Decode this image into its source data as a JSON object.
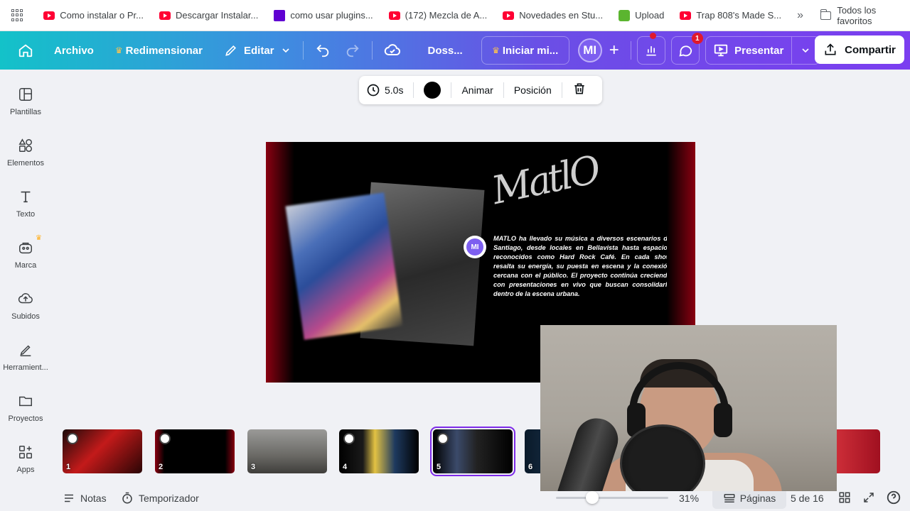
{
  "bookmarks": {
    "items": [
      {
        "label": "Como instalar o Pr...",
        "icon": "youtube-icon"
      },
      {
        "label": "Descargar Instalar...",
        "icon": "youtube-icon"
      },
      {
        "label": "como usar plugins...",
        "icon": "yahoo-icon"
      },
      {
        "label": "(172) Mezcla de A...",
        "icon": "youtube-icon"
      },
      {
        "label": "Novedades en Stu...",
        "icon": "youtube-icon"
      },
      {
        "label": "Upload",
        "icon": "upload-icon"
      },
      {
        "label": "Trap 808's Made S...",
        "icon": "youtube-icon"
      }
    ],
    "more": "»",
    "all_bookmarks": "Todos los favoritos"
  },
  "header": {
    "archivo": "Archivo",
    "redimensionar": "Redimensionar",
    "editar": "Editar",
    "design_title": "Doss...",
    "iniciar": "Iniciar mi...",
    "avatar": "MI",
    "comments_badge": "1",
    "presentar": "Presentar",
    "compartir": "Compartir"
  },
  "sidebar": {
    "items": [
      {
        "label": "Plantillas",
        "icon": "templates-icon"
      },
      {
        "label": "Elementos",
        "icon": "elements-icon"
      },
      {
        "label": "Texto",
        "icon": "text-icon"
      },
      {
        "label": "Marca",
        "icon": "brand-icon"
      },
      {
        "label": "Subidos",
        "icon": "uploads-icon"
      },
      {
        "label": "Herramient...",
        "icon": "tools-icon"
      },
      {
        "label": "Proyectos",
        "icon": "projects-icon"
      },
      {
        "label": "Apps",
        "icon": "apps-icon"
      }
    ]
  },
  "element_toolbar": {
    "duration": "5.0s",
    "color": "#000000",
    "animar": "Animar",
    "posicion": "Posición"
  },
  "slide": {
    "signature": "MatlO",
    "body": "MATLO ha llevado su música a diversos escenarios de Santiago, desde locales en Bellavista hasta espacios reconocidos como Hard Rock Café. En cada show resalta su energía, su puesta en escena y la conexión cercana con el público. El proyecto continúa creciendo con presentaciones en vivo que buscan consolidarlo dentro de la escena urbana.",
    "comment_avatar": "MI"
  },
  "thumbnails": [
    {
      "num": "1"
    },
    {
      "num": "2"
    },
    {
      "num": "3"
    },
    {
      "num": "4"
    },
    {
      "num": "5"
    },
    {
      "num": "6"
    }
  ],
  "bottom": {
    "notas": "Notas",
    "temporizador": "Temporizador",
    "zoom": "31%",
    "zoom_fraction": 0.31,
    "paginas": "Páginas",
    "page_counter": "5 de 16"
  },
  "colors": {
    "accent": "#7d2ae8",
    "badge": "#e0192d",
    "avatar": "#7d5ff0"
  }
}
